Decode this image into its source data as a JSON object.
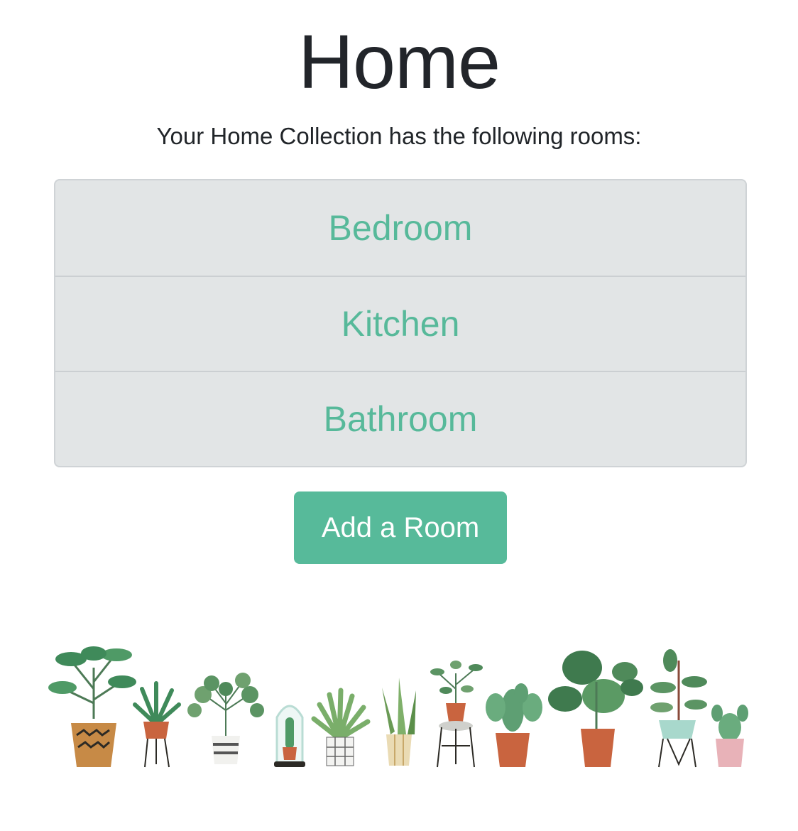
{
  "page": {
    "title": "Home",
    "subtitle": "Your Home Collection has the following rooms:"
  },
  "rooms": [
    {
      "label": "Bedroom"
    },
    {
      "label": "Kitchen"
    },
    {
      "label": "Bathroom"
    }
  ],
  "actions": {
    "add_room_label": "Add a Room"
  },
  "colors": {
    "accent": "#57ba9a",
    "list_background": "#e2e5e6",
    "title": "#22252a"
  },
  "decor": {
    "illustration": "potted-plants-illustration"
  }
}
